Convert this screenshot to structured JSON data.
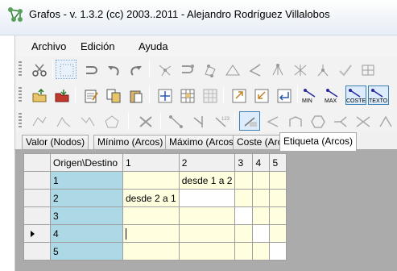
{
  "window": {
    "title": "Grafos - v. 1.3.2  (cc) 2003..2011 - Alejandro Rodríguez Villalobos"
  },
  "menu": [
    "Archivo",
    "Edición",
    "Ayuda"
  ],
  "toolbar2_labels": [
    "MIN",
    "MAX",
    "COSTE",
    "TEXTO"
  ],
  "tabs": [
    "Valor (Nodos)",
    "Mínimo (Arcos)",
    "Máximo (Arcos)",
    "Coste (Arcos)",
    "Etiqueta (Arcos)"
  ],
  "active_tab": "Etiqueta (Arcos)",
  "grid": {
    "corner_label": "Origen\\Destino",
    "columns": [
      "1",
      "2",
      "3",
      "4",
      "5"
    ],
    "rows": [
      {
        "label": "1",
        "cells": [
          "",
          "desde 1 a 2",
          "",
          "",
          ""
        ]
      },
      {
        "label": "2",
        "cells": [
          "desde 2 a 1",
          "",
          "",
          "",
          ""
        ]
      },
      {
        "label": "3",
        "cells": [
          "",
          "",
          "",
          "",
          ""
        ]
      },
      {
        "label": "4",
        "cells": [
          "",
          "",
          "",
          "",
          ""
        ]
      },
      {
        "label": "5",
        "cells": [
          "",
          "",
          "",
          "",
          ""
        ]
      }
    ],
    "current_row": "4"
  }
}
